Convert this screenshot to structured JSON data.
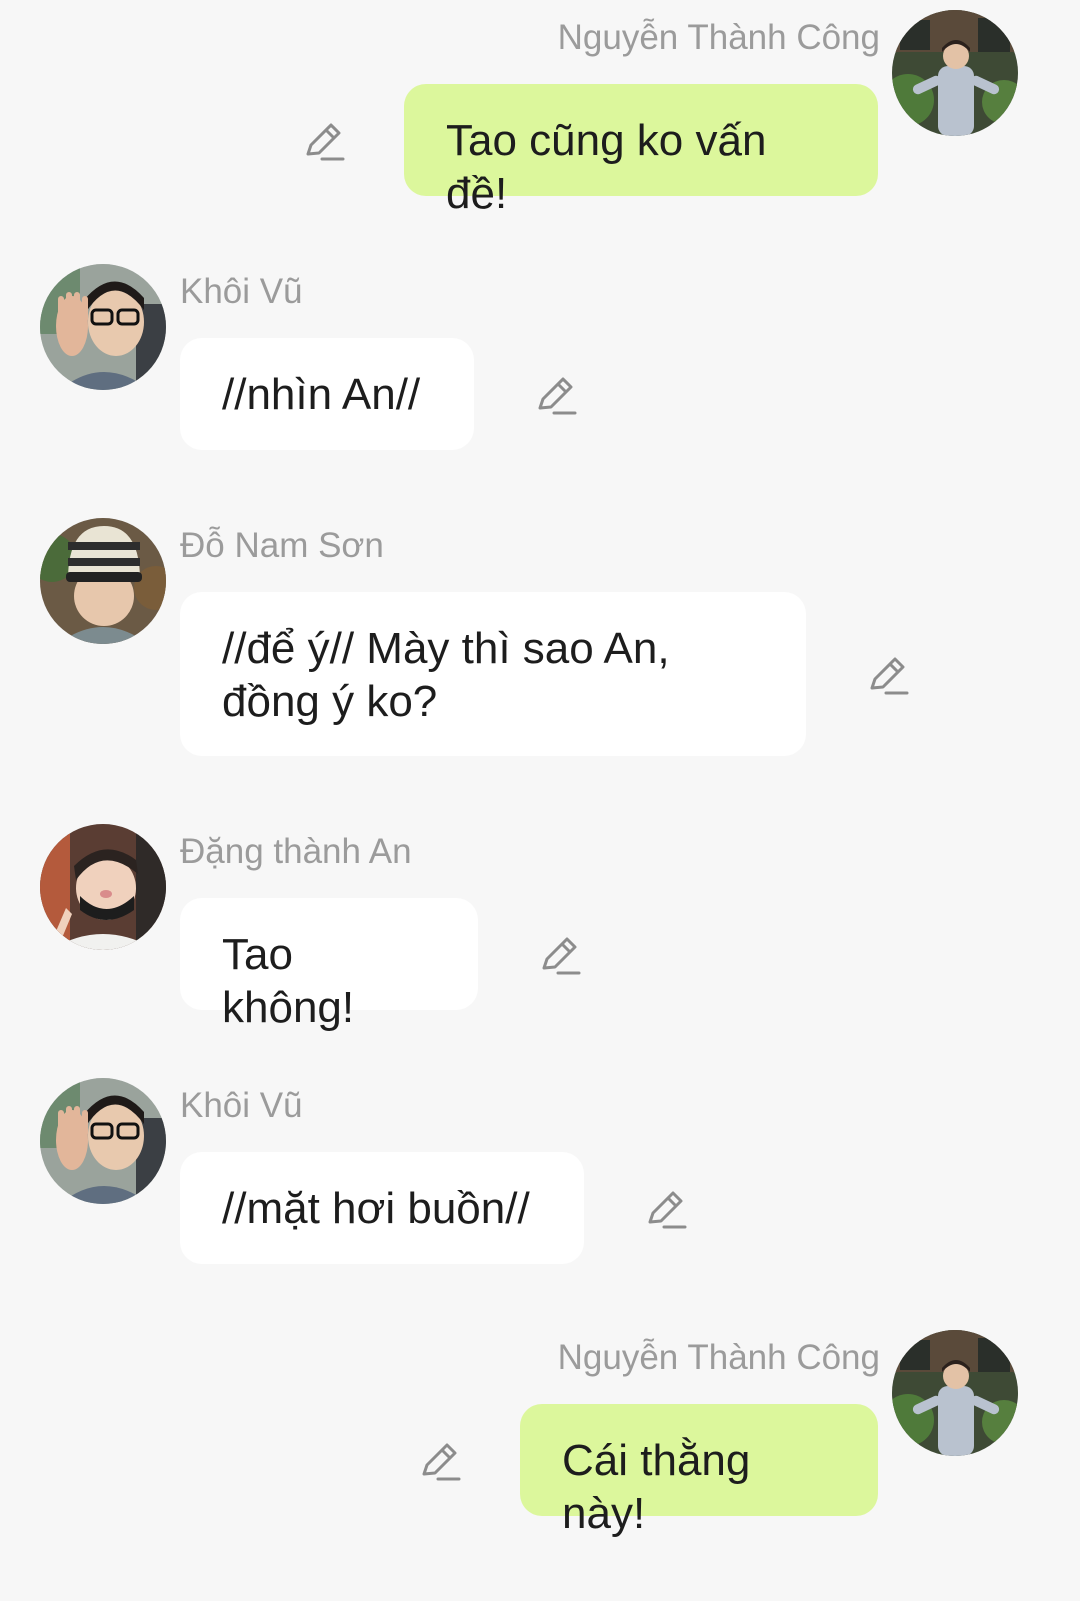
{
  "messages": [
    {
      "sender": "Nguyễn Thành Công",
      "text": "Tao cũng ko vấn đề!",
      "outgoing": true,
      "avatar_icon": "avatar-nguyen-thanh-cong"
    },
    {
      "sender": "Khôi Vũ",
      "text": "//nhìn An//",
      "outgoing": false,
      "avatar_icon": "avatar-khoi-vu"
    },
    {
      "sender": "Đỗ Nam Sơn",
      "text": "//để ý// Mày thì sao An, đồng ý ko?",
      "outgoing": false,
      "avatar_icon": "avatar-do-nam-son"
    },
    {
      "sender": "Đặng thành An",
      "text": "Tao không!",
      "outgoing": false,
      "avatar_icon": "avatar-dang-thanh-an"
    },
    {
      "sender": "Khôi Vũ",
      "text": "//mặt hơi buồn//",
      "outgoing": false,
      "avatar_icon": "avatar-khoi-vu"
    },
    {
      "sender": "Nguyễn Thành Công",
      "text": "Cái thằng này!",
      "outgoing": true,
      "avatar_icon": "avatar-nguyen-thanh-cong"
    }
  ],
  "icons": {
    "edit": "pencil-icon"
  },
  "colors": {
    "background": "#f7f7f7",
    "incoming_bubble": "#ffffff",
    "outgoing_bubble": "#dcf79c",
    "sender_name": "#9b9b9b",
    "message_text": "#1d1d1d"
  }
}
